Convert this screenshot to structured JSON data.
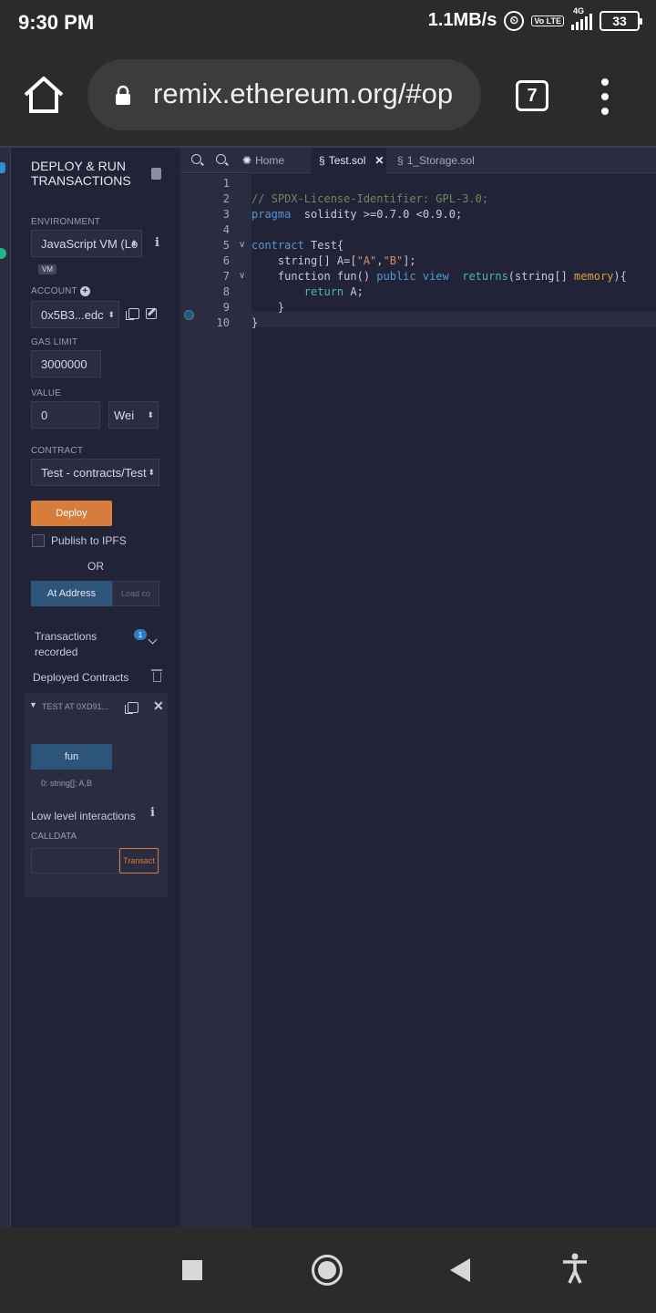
{
  "status": {
    "time": "9:30 PM",
    "speed": "1.1MB/s",
    "volte": "Vo LTE",
    "network": "4G",
    "battery": "33"
  },
  "browser": {
    "url": "remix.ethereum.org/#op",
    "tab_count": "7"
  },
  "panel": {
    "title": "DEPLOY & RUN TRANSACTIONS",
    "environment_label": "ENVIRONMENT",
    "environment_value": "JavaScript VM (Lo",
    "vm_badge": "VM",
    "account_label": "ACCOUNT",
    "account_value": "0x5B3...edc",
    "gas_limit_label": "GAS LIMIT",
    "gas_limit_value": "3000000",
    "value_label": "VALUE",
    "value_value": "0",
    "value_unit": "Wei",
    "contract_label": "CONTRACT",
    "contract_value": "Test - contracts/Test",
    "deploy_label": "Deploy",
    "publish_label": "Publish to IPFS",
    "or_label": "OR",
    "at_address_label": "At Address",
    "load_contract_label": "Load co",
    "transactions_recorded_label": "Transactions recorded",
    "transactions_count": "1",
    "deployed_contracts_label": "Deployed Contracts",
    "instance_label": "TEST AT 0XD91...",
    "fun_button_label": "fun",
    "fun_output": "0: string[]: A,B",
    "low_level_label": "Low level interactions",
    "calldata_label": "CALLDATA",
    "transact_label": "Transact"
  },
  "editor": {
    "tabs": [
      {
        "label": "Home"
      },
      {
        "label": "Test.sol",
        "active": true
      },
      {
        "label": "1_Storage.sol"
      }
    ],
    "line_numbers": [
      "1",
      "2",
      "3",
      "4",
      "5",
      "6",
      "7",
      "8",
      "9",
      "10"
    ],
    "code": {
      "l2": "// SPDX-License-Identifier: GPL-3.0;",
      "l3_kw": "pragma",
      "l3_rest": "  solidity >=0.7.0 <0.9.0;",
      "l5_kw": "contract",
      "l5_rest": " Test{",
      "l6_a": "    string[] A=[",
      "l6_s1": "\"A\"",
      "l6_c": ",",
      "l6_s2": "\"B\"",
      "l6_e": "];",
      "l7_a": "    function fun() ",
      "l7_kw": "public view",
      "l7_b": "  ",
      "l7_ret": "returns",
      "l7_c": "(string[] ",
      "l7_mem": "memory",
      "l7_d": "){",
      "l8_a": "        ",
      "l8_kw": "return",
      "l8_b": " A;",
      "l9": "    }",
      "l10": "}"
    }
  }
}
